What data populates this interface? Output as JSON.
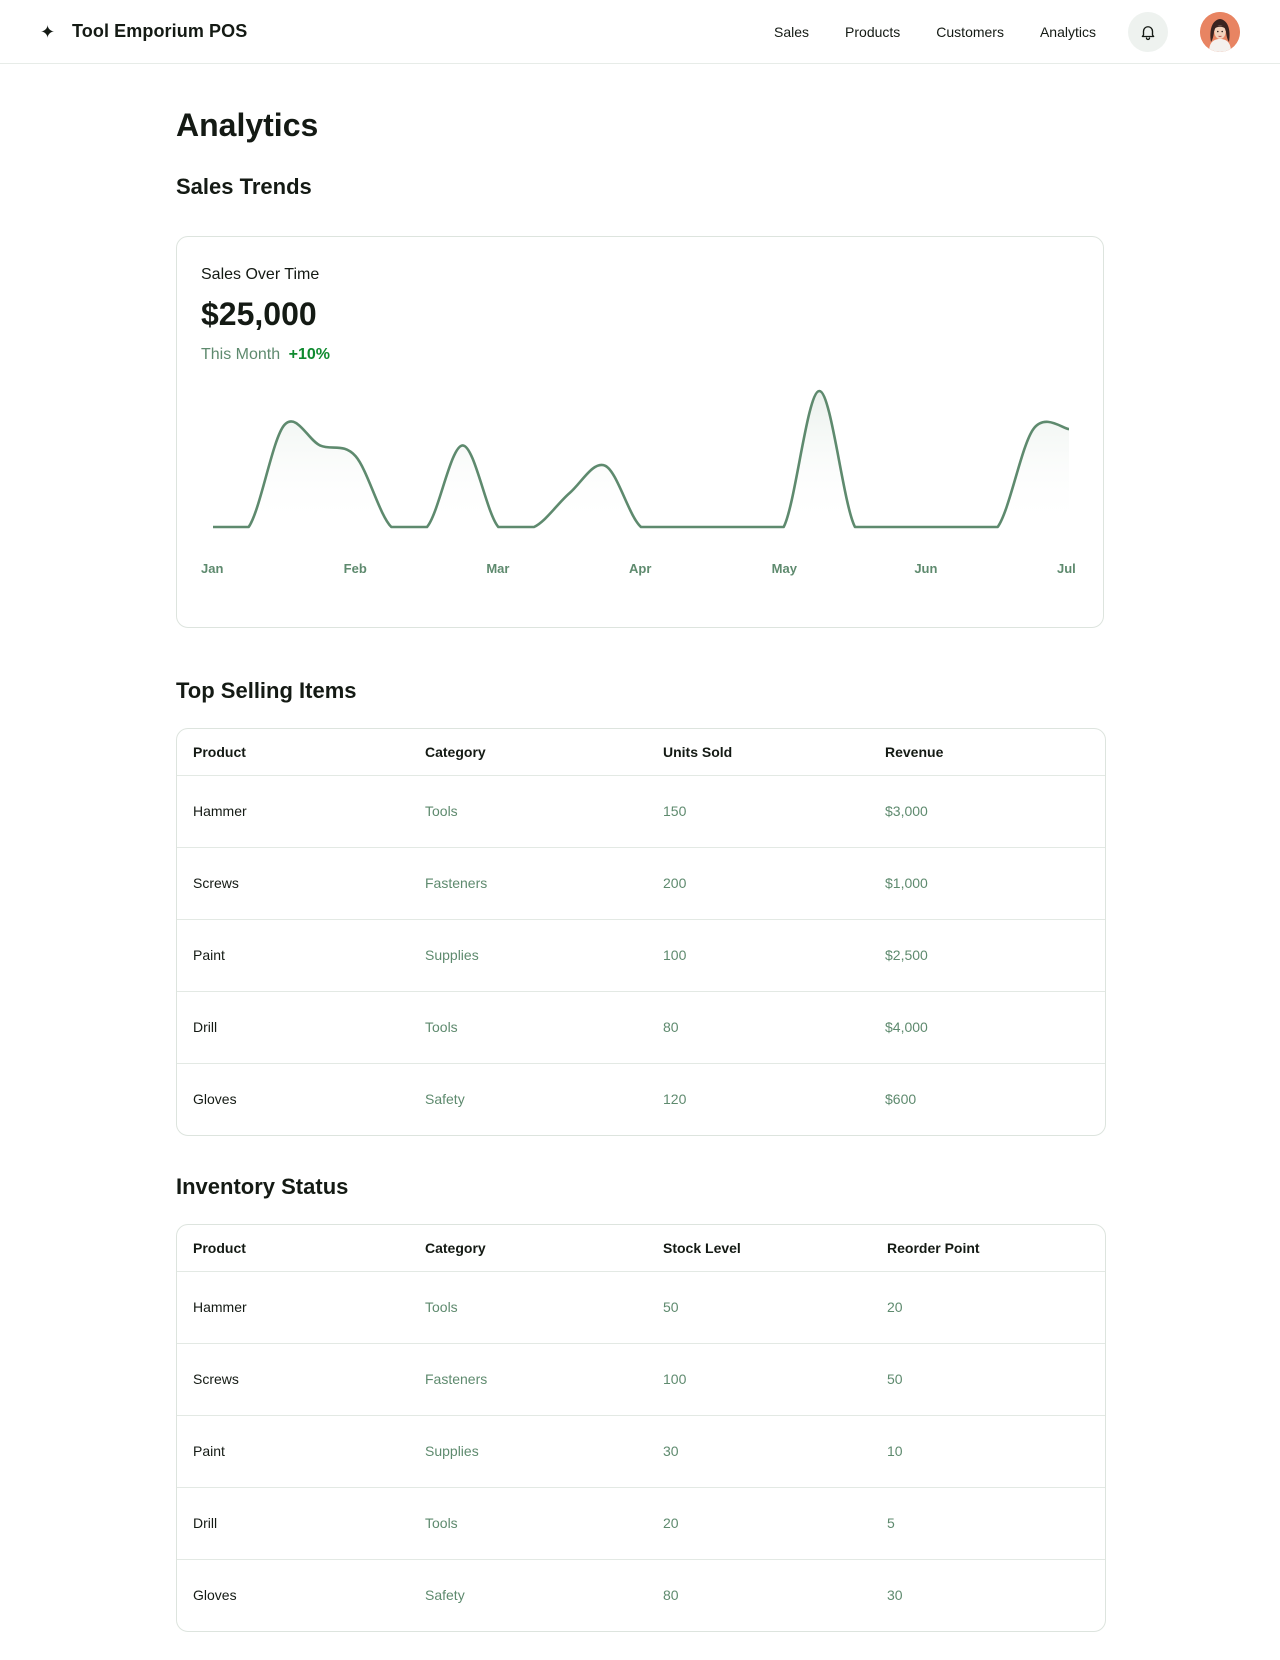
{
  "app": {
    "title": "Tool Emporium POS",
    "logo_icon": "sparkle-icon"
  },
  "nav": {
    "items": [
      "Sales",
      "Products",
      "Customers",
      "Analytics"
    ],
    "notifications_icon": "bell-icon"
  },
  "page": {
    "title": "Analytics"
  },
  "sales_trends": {
    "section_title": "Sales Trends",
    "card_label": "Sales Over Time",
    "value": "$25,000",
    "period": "This Month",
    "change": "+10%"
  },
  "chart_data": {
    "type": "line",
    "categories": [
      "Jan",
      "Feb",
      "Mar",
      "Apr",
      "May",
      "Jun",
      "Jul"
    ],
    "x": [
      0,
      0.25,
      0.5,
      0.75,
      1,
      1.25,
      1.5,
      1.75,
      2,
      2.25,
      2.5,
      2.75,
      3,
      3.25,
      3.5,
      3.75,
      4,
      4.25,
      4.5,
      4.75,
      5,
      5.25,
      5.5,
      5.75,
      6
    ],
    "series": [
      {
        "values": [
          0,
          0,
          0.75,
          0.6,
          0.52,
          0,
          0,
          0.6,
          0,
          0,
          0.25,
          0.45,
          0,
          0,
          0,
          0,
          0,
          1.0,
          0,
          0,
          0,
          0,
          0,
          0.72,
          0.72
        ]
      }
    ],
    "stroke_color": "#5e8a6e",
    "grid": false
  },
  "top_selling": {
    "section_title": "Top Selling Items",
    "columns": [
      "Product",
      "Category",
      "Units Sold",
      "Revenue"
    ],
    "rows": [
      [
        "Hammer",
        "Tools",
        "150",
        "$3,000"
      ],
      [
        "Screws",
        "Fasteners",
        "200",
        "$1,000"
      ],
      [
        "Paint",
        "Supplies",
        "100",
        "$2,500"
      ],
      [
        "Drill",
        "Tools",
        "80",
        "$4,000"
      ],
      [
        "Gloves",
        "Safety",
        "120",
        "$600"
      ]
    ]
  },
  "inventory": {
    "section_title": "Inventory Status",
    "columns": [
      "Product",
      "Category",
      "Stock Level",
      "Reorder Point"
    ],
    "rows": [
      [
        "Hammer",
        "Tools",
        "50",
        "20"
      ],
      [
        "Screws",
        "Fasteners",
        "100",
        "50"
      ],
      [
        "Paint",
        "Supplies",
        "30",
        "10"
      ],
      [
        "Drill",
        "Tools",
        "20",
        "5"
      ],
      [
        "Gloves",
        "Safety",
        "80",
        "30"
      ]
    ]
  }
}
